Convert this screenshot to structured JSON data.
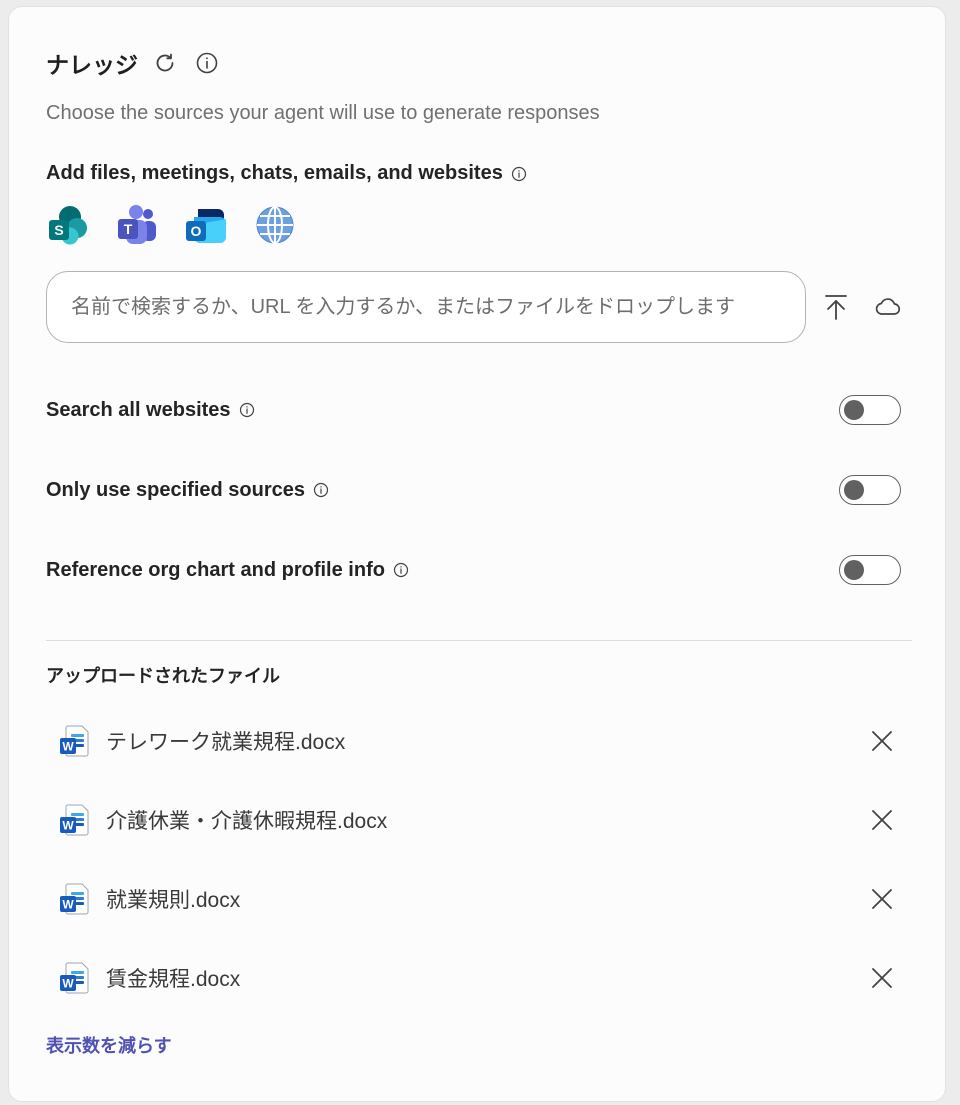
{
  "header": {
    "title": "ナレッジ"
  },
  "subtitle": "Choose the sources your agent will use to generate responses",
  "add_sources": {
    "label": "Add files, meetings, chats, emails, and websites",
    "icons": [
      "sharepoint-icon",
      "teams-icon",
      "outlook-icon",
      "globe-icon"
    ]
  },
  "search": {
    "placeholder": "名前で検索するか、URL を入力するか、またはファイルをドロップします",
    "value": ""
  },
  "toggles": [
    {
      "label": "Search all websites",
      "on": false
    },
    {
      "label": "Only use specified sources",
      "on": false
    },
    {
      "label": "Reference org chart and profile info",
      "on": false
    }
  ],
  "uploaded": {
    "heading": "アップロードされたファイル",
    "files": [
      {
        "name": "テレワーク就業規程.docx"
      },
      {
        "name": "介護休業・介護休暇規程.docx"
      },
      {
        "name": "就業規則.docx"
      },
      {
        "name": "賃金規程.docx"
      }
    ],
    "show_less_label": "表示数を減らす"
  },
  "colors": {
    "accent_link": "#4f52b2",
    "toggle_off": "#616161",
    "card_bg": "#fcfcfc"
  }
}
